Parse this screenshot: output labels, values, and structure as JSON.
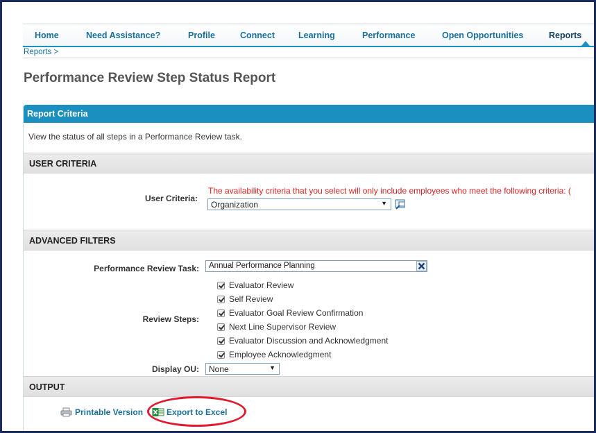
{
  "nav": {
    "items": [
      "Home",
      "Need Assistance?",
      "Profile",
      "Connect",
      "Learning",
      "Performance",
      "Open Opportunities",
      "Reports"
    ],
    "active": "Reports"
  },
  "breadcrumb": "Reports  >",
  "page_title": "Performance Review Step Status Report",
  "panel": {
    "header": "Report Criteria",
    "description": "View the status of all steps in a Performance Review task."
  },
  "user_criteria": {
    "section_title": "USER CRITERIA",
    "label": "User Criteria:",
    "warning": "The availability criteria that you select will only include employees who meet the following criteria: (",
    "selected": "Organization"
  },
  "advanced_filters": {
    "section_title": "ADVANCED FILTERS",
    "task_label": "Performance Review Task:",
    "task_value": "Annual Performance Planning",
    "steps_label": "Review Steps:",
    "steps": [
      "Evaluator Review",
      "Self Review",
      "Evaluator Goal Review Confirmation",
      "Next Line Supervisor Review",
      "Evaluator Discussion and Acknowledgment",
      "Employee Acknowledgment"
    ],
    "ou_label": "Display OU:",
    "ou_value": "None"
  },
  "output": {
    "section_title": "OUTPUT",
    "printable": "Printable Version",
    "export": "Export to Excel"
  },
  "colors": {
    "accent": "#1b8fbf",
    "link": "#1a6f9a",
    "warning": "#dd2222",
    "highlight_circle": "#e3192e"
  }
}
